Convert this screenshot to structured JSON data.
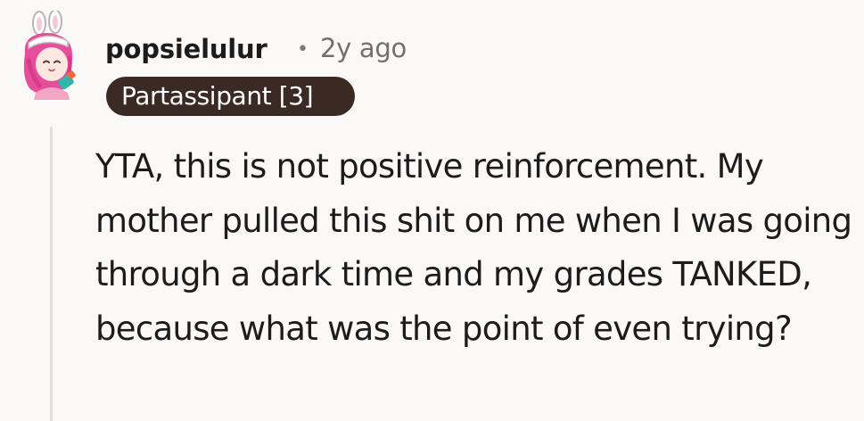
{
  "comment": {
    "author": "popsielulur",
    "separator": "•",
    "age": "2y ago",
    "flair": "Partassipant [3]",
    "body": "YTA, this is not positive reinforcement. My mother pulled this shit on me when I was going through a dark time and my grades TANKED, because what was the point of even trying?"
  },
  "colors": {
    "background": "#fbf9f8",
    "flair_background": "#3b2a24",
    "flair_text": "#ffffff",
    "thread_line": "#e2dedc",
    "meta_text": "#707070"
  },
  "icons": {
    "avatar": "avatar-icon"
  }
}
